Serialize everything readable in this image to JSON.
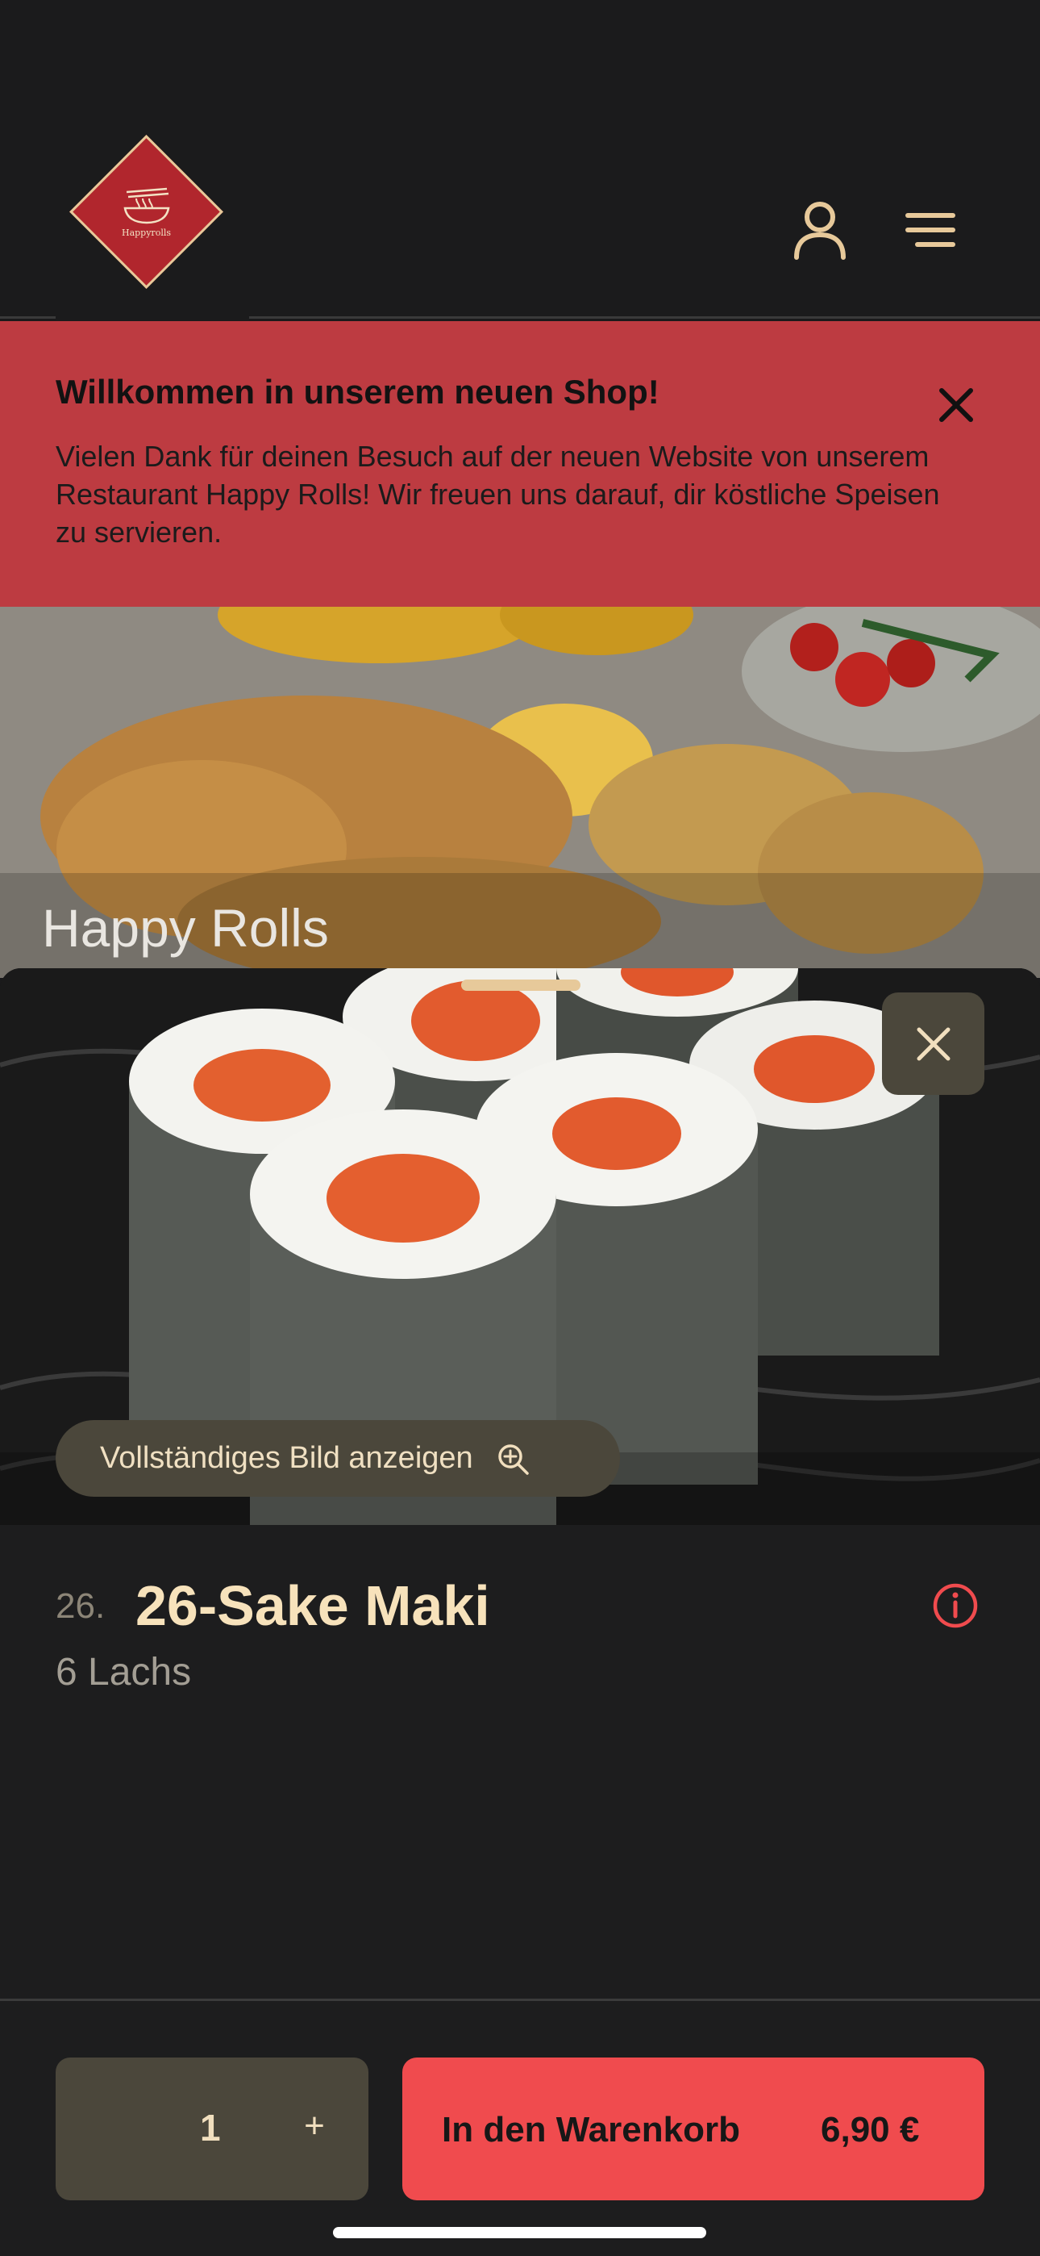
{
  "header": {
    "logo_text": "Happyrolls",
    "user_icon": "user-icon",
    "menu_icon": "hamburger-menu-icon"
  },
  "banner": {
    "title": "Willkommen in unserem neuen Shop!",
    "text": "Vielen Dank für deinen Besuch auf der neuen Website von unserem Restaurant Happy Rolls! Wir freuen uns darauf, dir köstliche Speisen zu servieren.",
    "close_icon": "close-icon"
  },
  "hero": {
    "title": "Happy Rolls"
  },
  "product": {
    "number": "26.",
    "name": "26-Sake Maki",
    "description": "6 Lachs",
    "full_image_label": "Vollständiges Bild anzeigen",
    "zoom_icon": "zoom-in-icon",
    "info_icon": "info-icon"
  },
  "cart": {
    "quantity": "1",
    "plus": "+",
    "add_label": "In den Warenkorb",
    "price": "6,90 €"
  },
  "colors": {
    "accent_red": "#f04b4e",
    "banner_red": "#bd3b41",
    "gold": "#f7e2bb",
    "dark_bg": "#1d1d1e",
    "button_dark": "#4b473b"
  }
}
